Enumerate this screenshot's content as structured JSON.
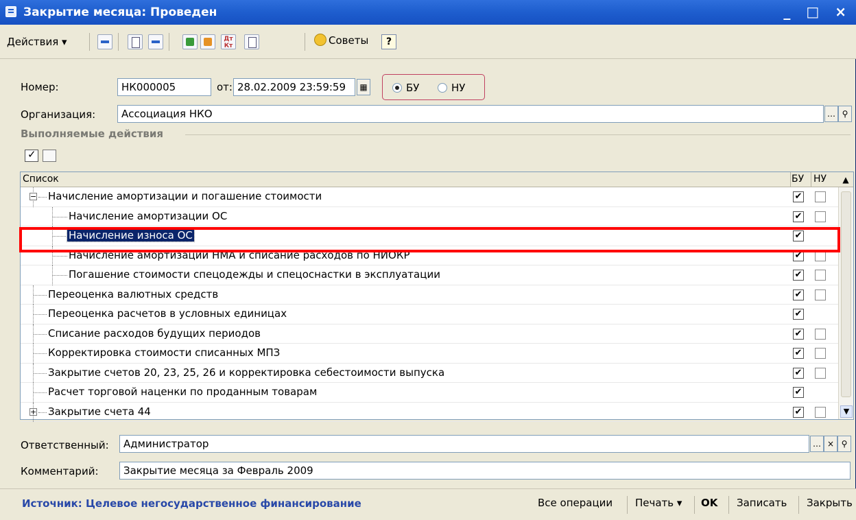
{
  "window": {
    "title": "Закрытие месяца: Проведен",
    "controls": "_ □ ×"
  },
  "toolbar": {
    "actions_label": "Действия ▾",
    "icons": [
      "arrow-left-icon",
      "refresh-icon",
      "move-icon",
      "post-icon",
      "unpost-icon",
      "dt-kt-icon",
      "report-icon"
    ],
    "dt_kt_label": "Дт\nКт",
    "tips_label": "Советы",
    "help_label": "?"
  },
  "header": {
    "number_label": "Номер:",
    "number_value": "НК000005",
    "date_label": "от:",
    "date_value": "28.02.2009 23:59:59",
    "radio_bu": "БУ",
    "radio_nu": "НУ",
    "radio_selected": "БУ",
    "org_label": "Организация:",
    "org_value": "Ассоциация НКО"
  },
  "section": {
    "title": "Выполняемые действия"
  },
  "table": {
    "col_list": "Список",
    "col_bu": "БУ",
    "col_nu": "НУ",
    "rows": [
      {
        "label": "Начисление амортизации и погашение стоимости",
        "level": 0,
        "expander": "−",
        "bu": true,
        "nu": false,
        "nu_visible": true
      },
      {
        "label": "Начисление амортизации ОС",
        "level": 1,
        "bu": true,
        "nu": false,
        "nu_visible": true
      },
      {
        "label": "Начисление износа ОС",
        "level": 1,
        "bu": true,
        "nu": false,
        "nu_visible": false,
        "selected": true
      },
      {
        "label": "Начисление амортизации НМА и списание расходов по НИОКР",
        "level": 1,
        "bu": true,
        "nu": false,
        "nu_visible": true
      },
      {
        "label": "Погашение стоимости спецодежды и спецоснастки в эксплуатации",
        "level": 1,
        "bu": true,
        "nu": false,
        "nu_visible": true
      },
      {
        "label": "Переоценка валютных средств",
        "level": 0,
        "bu": true,
        "nu": false,
        "nu_visible": true
      },
      {
        "label": "Переоценка расчетов в условных единицах",
        "level": 0,
        "bu": true,
        "nu": false,
        "nu_visible": false
      },
      {
        "label": "Списание расходов будущих периодов",
        "level": 0,
        "bu": true,
        "nu": false,
        "nu_visible": true
      },
      {
        "label": "Корректировка стоимости списанных МПЗ",
        "level": 0,
        "bu": true,
        "nu": false,
        "nu_visible": true
      },
      {
        "label": "Закрытие счетов 20, 23, 25, 26 и корректировка себестоимости выпуска",
        "level": 0,
        "bu": true,
        "nu": false,
        "nu_visible": true
      },
      {
        "label": "Расчет торговой наценки по проданным товарам",
        "level": 0,
        "bu": true,
        "nu": false,
        "nu_visible": false
      },
      {
        "label": "Закрытие счета 44",
        "level": 0,
        "expander": "+",
        "bu": true,
        "nu": false,
        "nu_visible": true
      }
    ]
  },
  "responsible": {
    "label": "Ответственный:",
    "value": "Администратор"
  },
  "comment": {
    "label": "Комментарий:",
    "value": "Закрытие месяца за Февраль 2009"
  },
  "footer": {
    "source": "Источник: Целевое негосударственное финансирование",
    "all_ops": "Все операции",
    "print": "Печать ▾",
    "ok": "OK",
    "save": "Записать",
    "close": "Закрыть"
  },
  "colors": {
    "titlebar": "#1f5fcf",
    "selection": "#0a246a",
    "highlight_box": "#ff0000",
    "source_text": "#2848a8"
  }
}
